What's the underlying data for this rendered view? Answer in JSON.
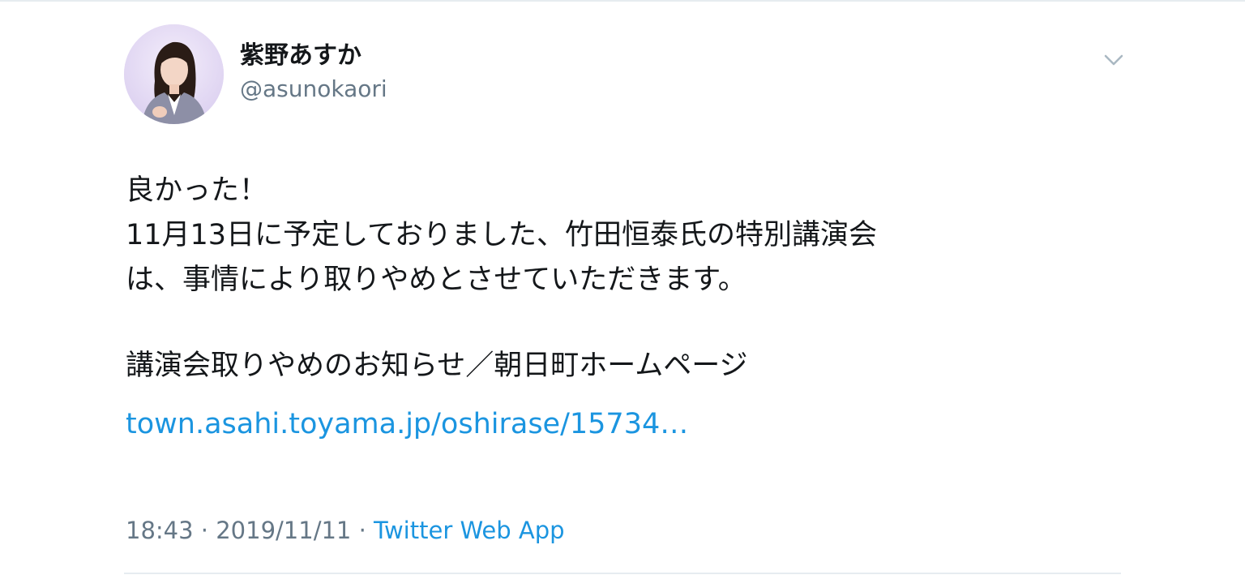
{
  "user": {
    "display_name": "紫野あすか",
    "handle": "@asunokaori"
  },
  "tweet": {
    "lines": [
      "良かった！",
      "11月13日に予定しておりました、竹田恒泰氏の特別講演会",
      "は、事情により取りやめとさせていただきます。"
    ],
    "link_title": "講演会取りやめのお知らせ／朝日町ホームページ",
    "link_url": "town.asahi.toyama.jp/oshirase/15734…"
  },
  "meta": {
    "time": "18:43",
    "separator": "·",
    "date": "2019/11/11",
    "source": "Twitter Web App"
  },
  "icons": {
    "menu": "chevron-down-icon",
    "avatar": "avatar"
  },
  "colors": {
    "text": "#14171a",
    "secondary": "#657786",
    "link": "#1b95e0",
    "divider": "#e6ecf0"
  }
}
